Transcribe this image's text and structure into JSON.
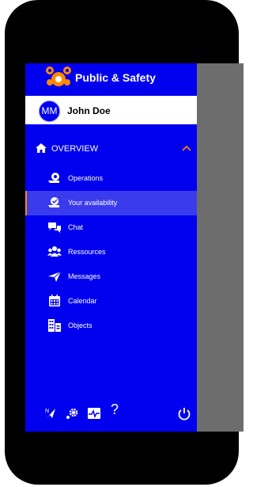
{
  "app": {
    "title": "Public & Safety"
  },
  "user": {
    "initials": "MM",
    "name": "John Doe"
  },
  "overview": {
    "label": "OVERVIEW",
    "expanded": true
  },
  "menu": {
    "items": [
      {
        "label": "Operations",
        "icon": "operations-icon",
        "active": false
      },
      {
        "label": "Your availability",
        "icon": "availability-icon",
        "active": true
      },
      {
        "label": "Chat",
        "icon": "chat-icon",
        "active": false
      },
      {
        "label": "Ressources",
        "icon": "resources-icon",
        "active": false
      },
      {
        "label": "Messages",
        "icon": "messages-icon",
        "active": false
      },
      {
        "label": "Calendar",
        "icon": "calendar-icon",
        "active": false
      },
      {
        "label": "Objects",
        "icon": "objects-icon",
        "active": false
      }
    ]
  },
  "footer": {
    "icons": [
      "compass-icon",
      "settings-icon",
      "activity-icon",
      "help-icon",
      "power-icon"
    ],
    "help_text": "?"
  },
  "colors": {
    "drawer": "#0000ee",
    "active_item": "#3b3bee",
    "accent": "#ff8a00",
    "overlay": "#6d6d6d",
    "text": "#ffffff"
  }
}
